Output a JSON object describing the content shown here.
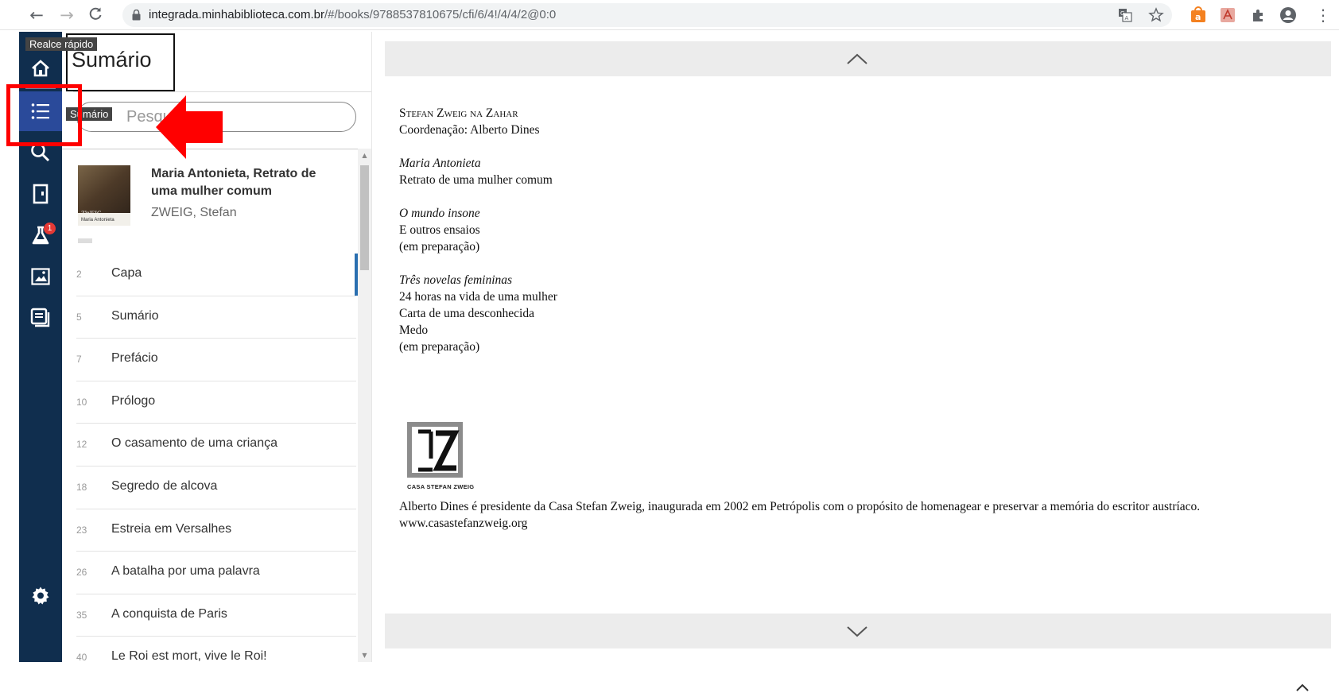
{
  "browser": {
    "url_host": "integrada.minhabiblioteca.com.br",
    "url_path": "/#/books/9788537810675/cfi/6/4!/4/4/2@0:0",
    "back_icon": "←",
    "forward_icon": "→",
    "reload_icon": "C",
    "menu_icon": "⋮"
  },
  "rail": {
    "tooltip_home": "Realce rápido",
    "tooltip_toc": "Sumário",
    "lab_badge": "1",
    "colors": {
      "bg": "#102e4e",
      "active": "#2a4a9a",
      "badge": "#e53935"
    }
  },
  "toc": {
    "title": "Sumário",
    "search_placeholder": "Pesquisar",
    "book": {
      "title": "Maria Antonieta, Retrato de uma mulher comum",
      "author": "ZWEIG, Stefan",
      "cover_brand": "ZWEIG",
      "cover_sub": "Maria Antonieta"
    },
    "items": [
      {
        "page": "2",
        "label": "Capa"
      },
      {
        "page": "5",
        "label": "Sumário"
      },
      {
        "page": "7",
        "label": "Prefácio"
      },
      {
        "page": "10",
        "label": "Prólogo"
      },
      {
        "page": "12",
        "label": "O casamento de uma criança"
      },
      {
        "page": "18",
        "label": "Segredo de alcova"
      },
      {
        "page": "23",
        "label": "Estreia em Versalhes"
      },
      {
        "page": "26",
        "label": "A batalha por uma palavra"
      },
      {
        "page": "35",
        "label": "A conquista de Paris"
      },
      {
        "page": "40",
        "label": "Le Roi est mort, vive le Roi!"
      }
    ]
  },
  "reader": {
    "header_line1": "Stefan Zweig na Zahar",
    "header_line2": "Coordenação: Alberto Dines",
    "work1_title": "Maria Antonieta",
    "work1_sub": "Retrato de uma mulher comum",
    "work2_title": "O mundo insone",
    "work2_sub": "E outros ensaios",
    "work2_note": "(em preparação)",
    "work3_title": "Três novelas femininas",
    "work3_l1": "24 horas na vida de uma mulher",
    "work3_l2": "Carta de uma desconhecida",
    "work3_l3": "Medo",
    "work3_note": "(em preparação)",
    "logo_label": "CASA STEFAN ZWEIG",
    "bio_text": "Alberto Dines é presidente da Casa Stefan Zweig, inaugurada em 2002 em Petrópolis com o propósito de homenagear e preservar a memória do escritor austríaco.",
    "bio_url": "www.casastefanzweig.org"
  }
}
